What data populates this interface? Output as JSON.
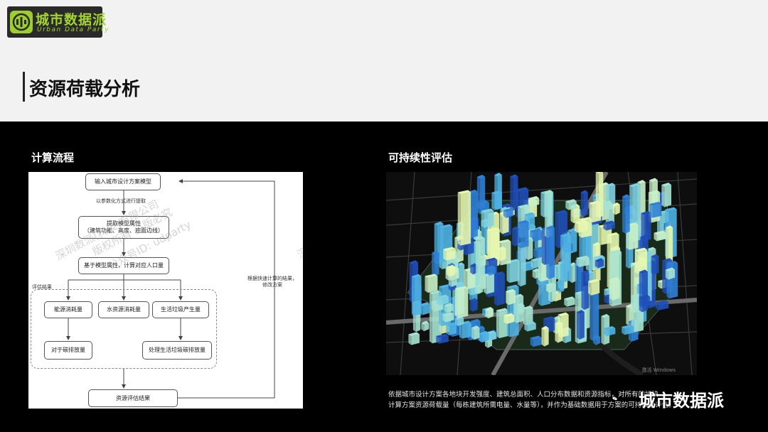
{
  "logo": {
    "title": "城市数据派",
    "subtitle": "Urban Data Party",
    "accent": "#9ccf2e"
  },
  "page": {
    "title": "资源荷载分析"
  },
  "left_section": {
    "label": "计算流程"
  },
  "right_section": {
    "label": "可持续性评估"
  },
  "flowchart": {
    "input": "输入城市设计方案模型",
    "extract_note": "以参数化方式进行提取",
    "attributes_line1": "提取模型属性",
    "attributes_line2": "（建筑功能、高度、底面边线）",
    "population": "基于模型属性，计算对应人口量",
    "group_label": "评估结果",
    "energy": "能源消耗量",
    "water": "水资源消耗量",
    "waste": "生活垃圾产生量",
    "carbon": "对于碳排放量",
    "waste_carbon": "处理生活垃圾碳排放量",
    "result": "资源评估结果",
    "feedback_line1": "根据快速计算的结果，",
    "feedback_line2": "修改方案"
  },
  "watermark": {
    "line1": "深圳数派(科技)有限公司",
    "line2": "版权所有 盗版必究",
    "line3": "公众号ID: udparty",
    "line4": "深"
  },
  "caption": {
    "line1": "依据城市设计方案各地块开发强度、建筑总面积、人口分布数据和资源指标，对所有的地块",
    "line2": "计算方案资源荷载量（每栋建筑所需电量、水量等），并作为基础数据用于方案的可持续性评估。"
  },
  "map": {
    "attribution": "激活 Windows"
  },
  "brand": {
    "wechat_name": "城市数据派"
  }
}
